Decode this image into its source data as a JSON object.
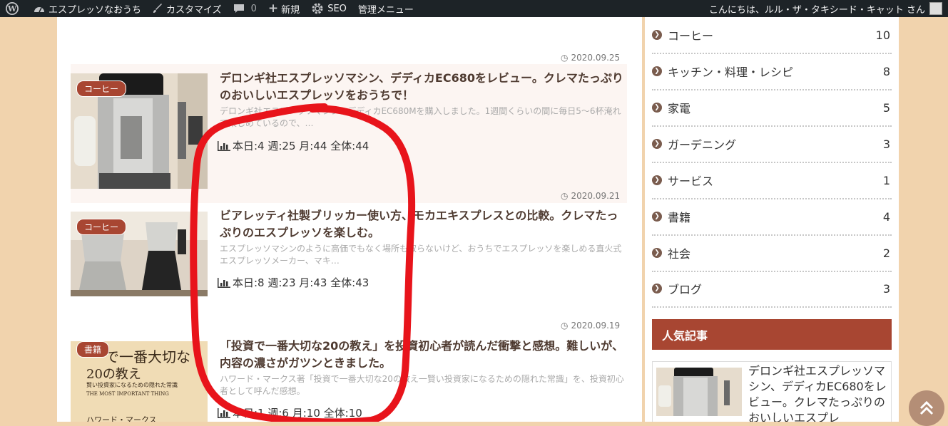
{
  "adminbar": {
    "site_name": "エスプレッソなおうち",
    "customize": "カスタマイズ",
    "comments_count": "0",
    "new": "新規",
    "seo": "SEO",
    "admin_menu": "管理メニュー",
    "greeting": "こんにちは、ルル・ザ・タキシード・キャット さん"
  },
  "posts": [
    {
      "date": "2020.09.25",
      "category": "コーヒー",
      "title": "デロンギ社エスプレッソマシン、デディカEC680をレビュー。クレマたっぷりのおいしいエスプレッソをおうちで！",
      "excerpt": "デロンギ社エスプレッソマシン、デディカEC680Mを購入しました。1週間くらいの間に毎日5～6杯淹れて楽しめているので、…",
      "stats": "本日:4 週:25 月:44 全体:44"
    },
    {
      "date": "2020.09.21",
      "category": "コーヒー",
      "title": "ビアレッティ社製ブリッカー使い方、モカエキスプレスとの比較。クレマたっぷりのエスプレッソを楽しむ。",
      "excerpt": "エスプレッソマシンのように高価でもなく場所も取らないけど、おうちでエスプレッソを楽しめる直火式エスプレッソメーカー、マキ…",
      "stats": "本日:8 週:23 月:43 全体:43"
    },
    {
      "date": "2020.09.19",
      "category": "書籍",
      "title": "「投資で一番大切な20の教え」を投資初心者が読んだ衝撃と感想。難しいが、内容の濃さがガツンときました。",
      "excerpt": "ハワード・マークス著「投資で一番大切な20の教え一賢い投資家になるための隠れた常識」を、投資初心者として呼んだ感想。",
      "stats": "本日:1 週:6 月:10 全体:10"
    }
  ],
  "sidebar": {
    "categories": [
      {
        "name": "コーヒー",
        "count": "10"
      },
      {
        "name": "キッチン・料理・レシピ",
        "count": "8"
      },
      {
        "name": "家電",
        "count": "5"
      },
      {
        "name": "ガーデニング",
        "count": "3"
      },
      {
        "name": "サービス",
        "count": "1"
      },
      {
        "name": "書籍",
        "count": "4"
      },
      {
        "name": "社会",
        "count": "2"
      },
      {
        "name": "ブログ",
        "count": "3"
      }
    ],
    "popular_title": "人気記事",
    "popular_item_title": "デロンギ社エスプレッソマシン、デディカEC680をレビュー。クレマたっぷりのおいしいエスプレ"
  },
  "book_cover": {
    "line1": "で一番大切な",
    "line2": "20の教え",
    "line3": "賢い投資家になるための隠れた常識",
    "line4": "THE MOST IMPORTANT THING",
    "line5": "ハワード・マークス"
  },
  "colors": {
    "adminbar_bg": "#1d2327",
    "accent": "#a84632",
    "page_bg": "#f1d3ad",
    "annotation": "#e8141b"
  }
}
